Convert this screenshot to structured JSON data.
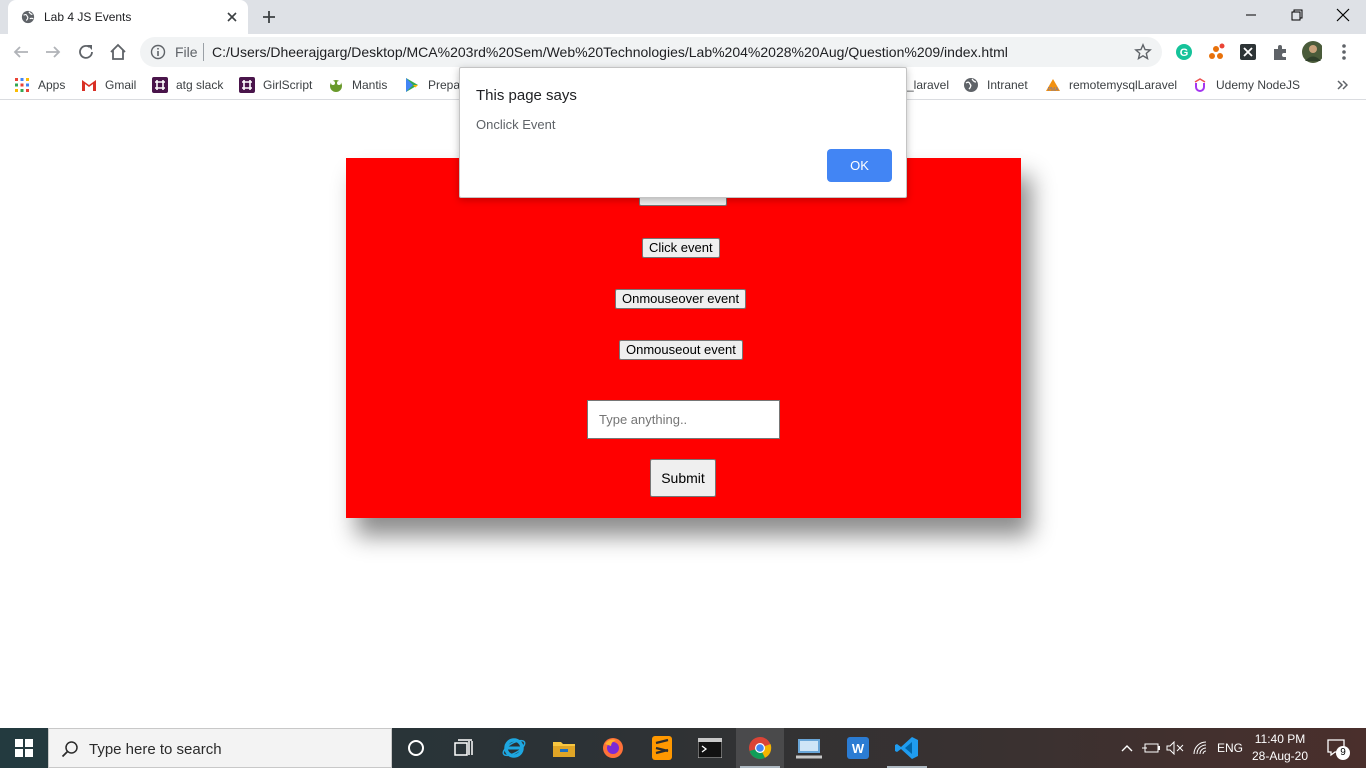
{
  "browser": {
    "tab": {
      "title": "Lab 4 JS Events",
      "icon": "globe-icon"
    },
    "address": {
      "security_label": "File",
      "url": "C:/Users/Dheerajgarg/Desktop/MCA%203rd%20Sem/Web%20Technologies/Lab%204%2028%20Aug/Question%209/index.html"
    },
    "bookmarks": [
      {
        "label": "Apps",
        "icon": "apps-grid-icon"
      },
      {
        "label": "Gmail",
        "icon": "gmail-icon"
      },
      {
        "label": "atg slack",
        "icon": "slack-icon"
      },
      {
        "label": "GirlScript",
        "icon": "slack-icon"
      },
      {
        "label": "Mantis",
        "icon": "mantis-icon"
      },
      {
        "label": "Prepa",
        "icon": "play-icon"
      },
      {
        "label": "_laravel",
        "icon": ""
      },
      {
        "label": "Intranet",
        "icon": "globe-icon"
      },
      {
        "label": "remotemysqlLaravel",
        "icon": "phpmyadmin-icon"
      },
      {
        "label": "Udemy NodeJS",
        "icon": "udemy-icon"
      }
    ]
  },
  "page": {
    "buttons": {
      "click_event": "Click event",
      "mouseover_event": "Onmouseover event",
      "mouseout_event": "Onmouseout event",
      "submit": "Submit"
    },
    "input": {
      "placeholder": "Type anything..",
      "value": ""
    },
    "box_color": "#ff0000"
  },
  "dialog": {
    "title": "This page says",
    "message": "Onclick Event",
    "ok_label": "OK"
  },
  "taskbar": {
    "search_placeholder": "Type here to search",
    "language": "ENG",
    "time": "11:40 PM",
    "date": "28-Aug-20",
    "notification_count": "9"
  }
}
